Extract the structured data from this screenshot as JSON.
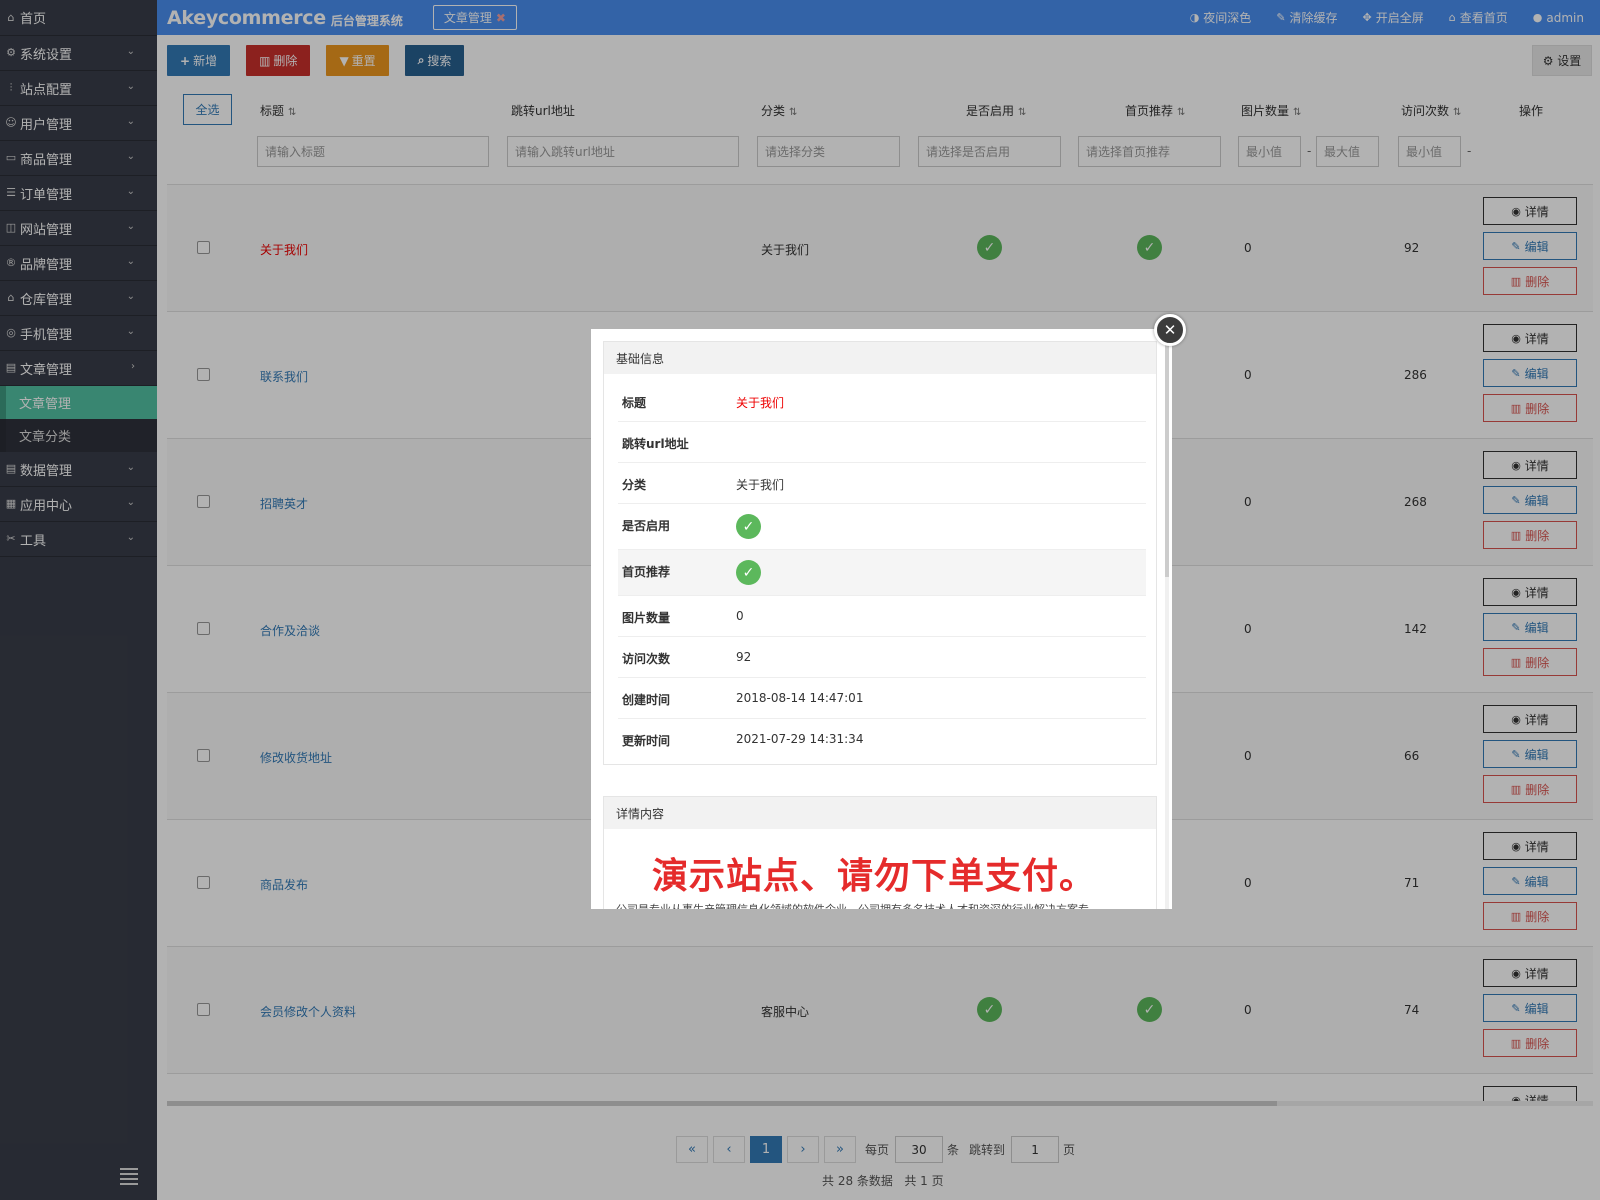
{
  "sidebar": {
    "home": "首页",
    "items": [
      {
        "label": "系统设置",
        "icon": "gear-icon"
      },
      {
        "label": "站点配置",
        "icon": "sliders-icon"
      },
      {
        "label": "用户管理",
        "icon": "user-icon"
      },
      {
        "label": "商品管理",
        "icon": "product-icon"
      },
      {
        "label": "订单管理",
        "icon": "order-icon"
      },
      {
        "label": "网站管理",
        "icon": "website-icon"
      },
      {
        "label": "品牌管理",
        "icon": "brand-icon"
      },
      {
        "label": "仓库管理",
        "icon": "warehouse-icon"
      },
      {
        "label": "手机管理",
        "icon": "phone-icon"
      },
      {
        "label": "文章管理",
        "icon": "article-icon"
      }
    ],
    "sub_items": [
      "文章管理",
      "文章分类"
    ],
    "items_after": [
      {
        "label": "数据管理",
        "icon": "database-icon"
      },
      {
        "label": "应用中心",
        "icon": "apps-icon"
      },
      {
        "label": "工具",
        "icon": "tools-icon"
      }
    ]
  },
  "header": {
    "brand": "Akeycommerce",
    "brand_sub": "后台管理系统",
    "tab": "文章管理",
    "links": [
      "夜间深色",
      "清除缓存",
      "开启全屏",
      "查看首页",
      "admin"
    ]
  },
  "toolbar": {
    "add": "新增",
    "delete": "删除",
    "reset": "重置",
    "search": "搜索",
    "settings": "设置"
  },
  "table": {
    "select_all": "全选",
    "headers": [
      "标题",
      "跳转url地址",
      "分类",
      "是否启用",
      "首页推荐",
      "图片数量",
      "访问次数",
      "操作"
    ],
    "filters": {
      "title": "请输入标题",
      "url": "请输入跳转url地址",
      "category": "请选择分类",
      "enabled": "请选择是否启用",
      "home_rec": "请选择首页推荐",
      "img_min": "最小值",
      "img_max": "最大值",
      "visit_min": "最小值"
    },
    "rows": [
      {
        "title": "关于我们",
        "category": "关于我们",
        "images": "0",
        "visits": "92"
      },
      {
        "title": "联系我们",
        "category": "",
        "images": "0",
        "visits": "286"
      },
      {
        "title": "招聘英才",
        "category": "",
        "images": "0",
        "visits": "268"
      },
      {
        "title": "合作及洽谈",
        "category": "",
        "images": "0",
        "visits": "142"
      },
      {
        "title": "修改收货地址",
        "category": "",
        "images": "0",
        "visits": "66"
      },
      {
        "title": "商品发布",
        "category": "",
        "images": "0",
        "visits": "71"
      },
      {
        "title": "会员修改个人资料",
        "category": "客服中心",
        "images": "0",
        "visits": "74"
      }
    ],
    "ops": {
      "detail": "详情",
      "edit": "编辑",
      "remove": "删除"
    }
  },
  "pager": {
    "first": "«",
    "prev": "‹",
    "current": "1",
    "next": "›",
    "last": "»",
    "per_page_label": "每页",
    "per_page": "30",
    "unit": "条",
    "jump_label": "跳转到",
    "jump_page": "1",
    "page_unit": "页",
    "summary": "共 28 条数据   共 1 页"
  },
  "modal": {
    "basic_title": "基础信息",
    "fields": [
      {
        "label": "标题",
        "value": "关于我们"
      },
      {
        "label": "跳转url地址",
        "value": ""
      },
      {
        "label": "分类",
        "value": "关于我们"
      },
      {
        "label": "是否启用",
        "value": ""
      },
      {
        "label": "首页推荐",
        "value": ""
      },
      {
        "label": "图片数量",
        "value": "0"
      },
      {
        "label": "访问次数",
        "value": "92"
      },
      {
        "label": "创建时间",
        "value": "2018-08-14 14:47:01"
      },
      {
        "label": "更新时间",
        "value": "2021-07-29 14:31:34"
      }
    ],
    "detail_title": "详情内容",
    "notice": "演示站点、请勿下单支付。",
    "intro": "公司是专业从事生产管理信息化领域的软件企业，公司拥有多名技术人才和资深的行业解决方案专"
  }
}
